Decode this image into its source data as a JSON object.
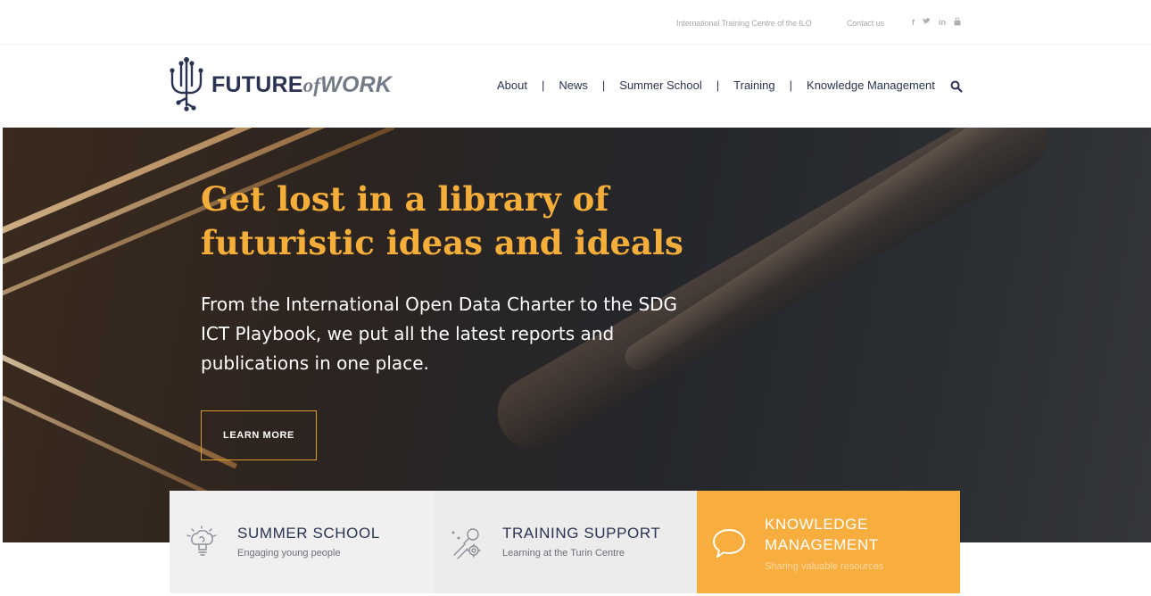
{
  "topbar": {
    "itc_link": "International Training Centre of the ILO",
    "contact_link": "Contact us",
    "social": [
      "f",
      "♥",
      "in",
      "⌂"
    ]
  },
  "header": {
    "logo_part1": "FUTURE",
    "logo_part2": "of",
    "logo_part3": "WORK",
    "nav": [
      "About",
      "News",
      "Summer School",
      "Training",
      "Knowledge Management"
    ],
    "separator": "|"
  },
  "hero": {
    "title": "Get lost in a library of futuristic ideas and ideals",
    "subtitle": "From the International Open Data Charter to the SDG ICT Playbook, we put all the latest reports and publications in one place.",
    "button": "LEARN MORE"
  },
  "cards": [
    {
      "title": "SUMMER SCHOOL",
      "desc": "Engaging young people",
      "icon": "brain-bulb-icon"
    },
    {
      "title": "TRAINING SUPPORT",
      "desc": "Learning at the Turin Centre",
      "icon": "tools-gear-icon"
    },
    {
      "title": "KNOWLEDGE MANAGEMENT",
      "desc": "Sharing valuable resources",
      "icon": "speech-bubble-icon"
    }
  ],
  "colors": {
    "brand_navy": "#2b3352",
    "accent_orange": "#f8ae3e",
    "hero_title": "#f6ae3b"
  }
}
